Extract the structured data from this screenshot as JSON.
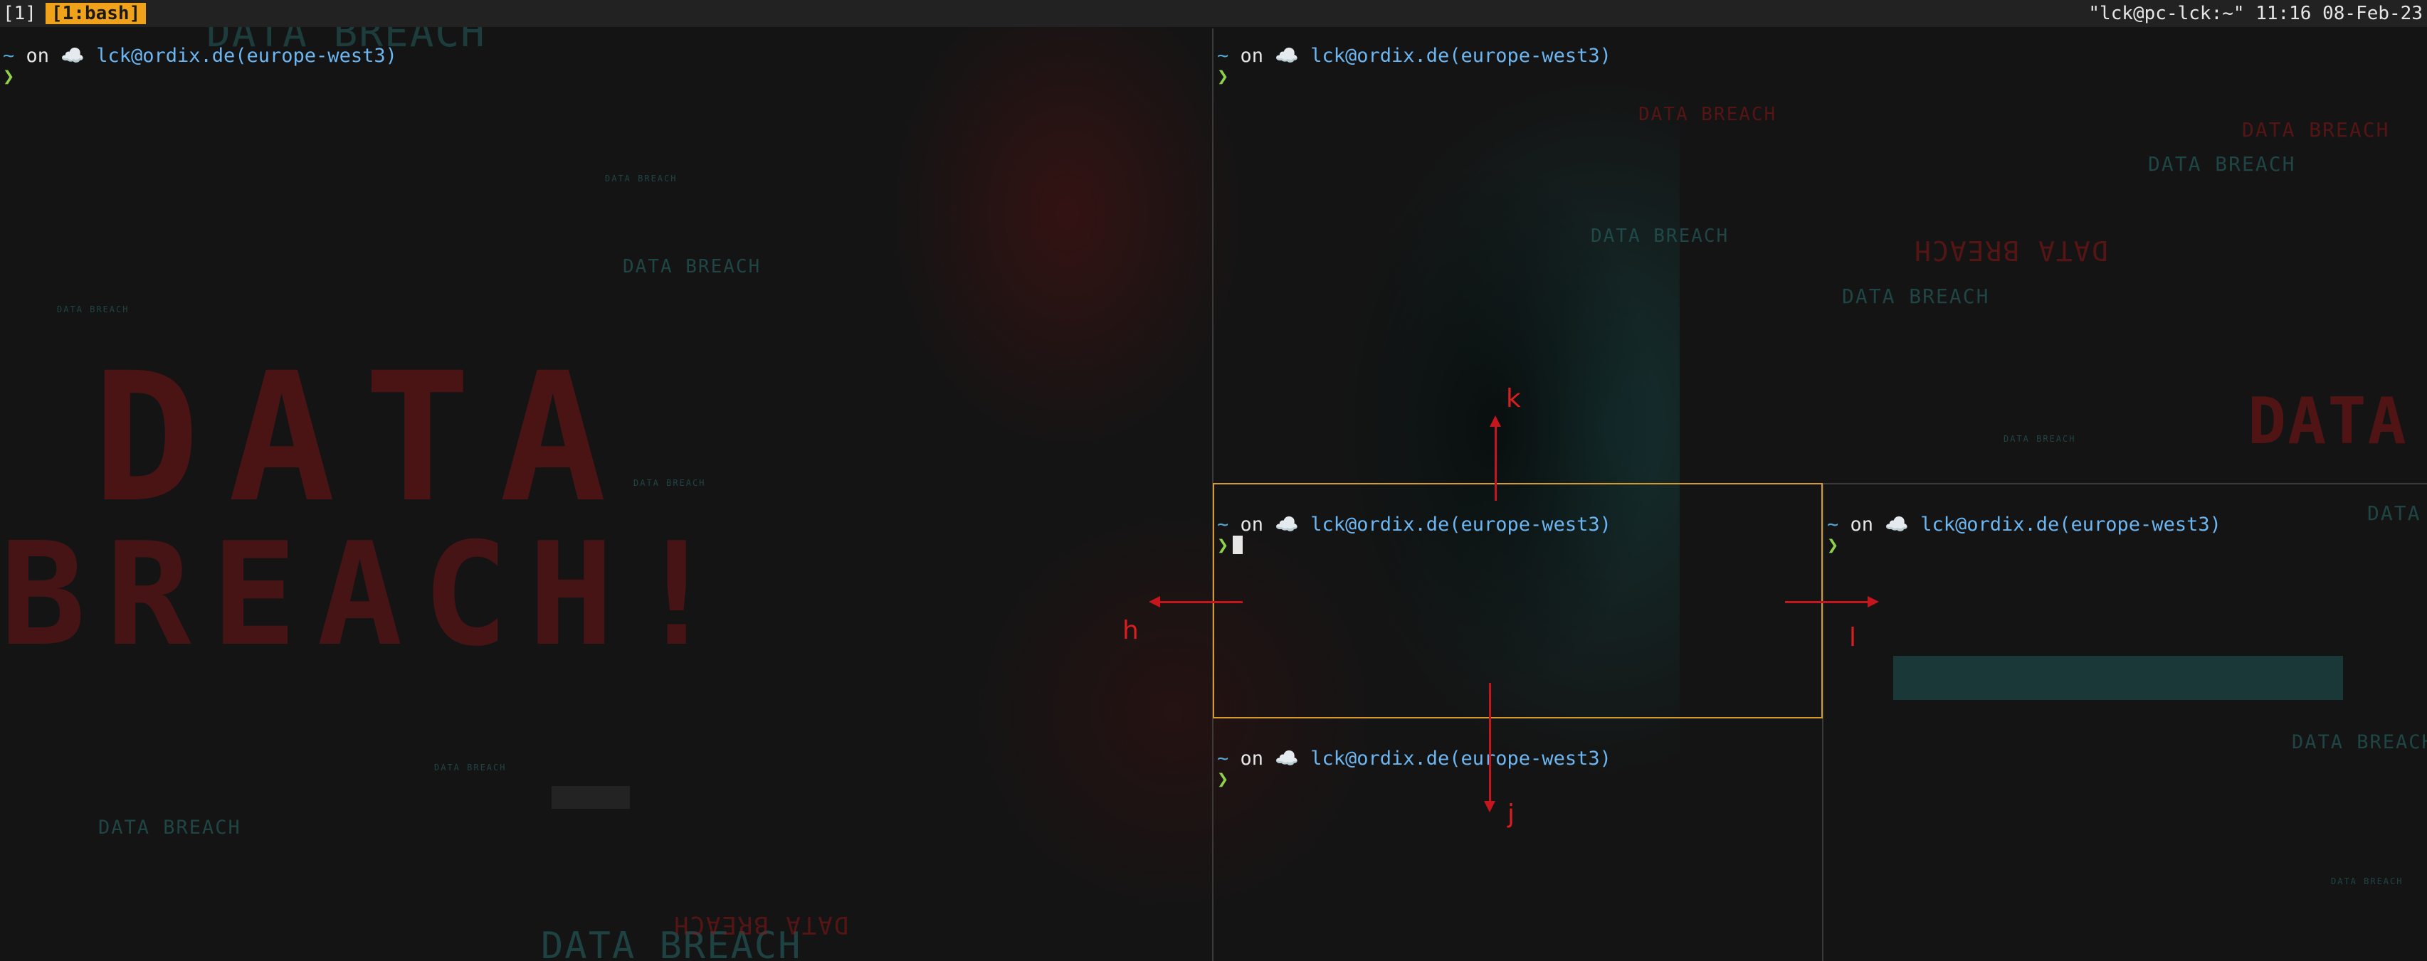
{
  "statusbar": {
    "session": "[1]",
    "window_tab": "[1:bash]",
    "right": "\"lck@pc-lck:~\" 11:16 08-Feb-23"
  },
  "prompt": {
    "tilde": "~",
    "on": "on",
    "cloud_icon": "☁️",
    "host": "lck@ordix.de(europe-west3)",
    "caret": "❯"
  },
  "panes": [
    {
      "name": "pane-top-left",
      "active": false
    },
    {
      "name": "pane-top-right",
      "active": false
    },
    {
      "name": "pane-center-active",
      "active": true
    },
    {
      "name": "pane-right",
      "active": false
    },
    {
      "name": "pane-bottom",
      "active": false
    }
  ],
  "navigation_keys": {
    "up": "k",
    "down": "j",
    "left": "h",
    "right": "l"
  },
  "wallpaper": {
    "big_word_1": "DATA",
    "big_word_2": "BREACH!",
    "small_text": "DATA BREACH",
    "red_big": "DATA",
    "bottom_text": "DATA BREACH",
    "mirrored_text": "DATA BREACH"
  },
  "colors": {
    "accent_tab": "#f0a21b",
    "active_border": "#d49a2a",
    "arrow_red": "#c4161c",
    "host_blue": "#6cb6f2",
    "caret_green": "#8fd14a"
  }
}
